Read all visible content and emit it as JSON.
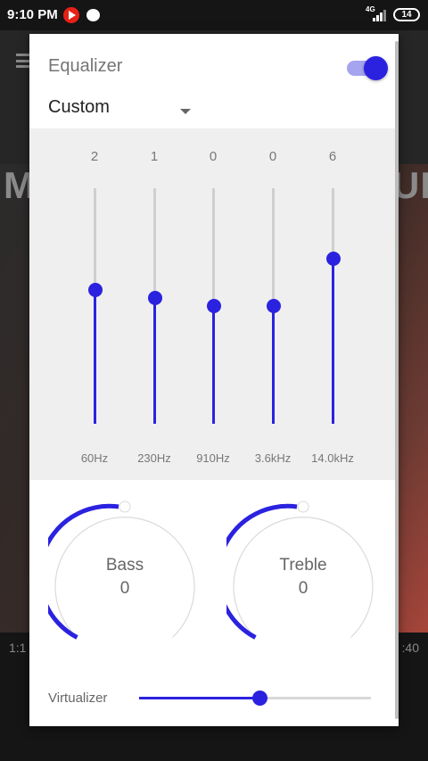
{
  "status_bar": {
    "time": "9:10 PM",
    "network": "4G",
    "battery": "14"
  },
  "background_player": {
    "elapsed": "1:1",
    "remaining": ":40",
    "title_fragment_left": "M",
    "title_fragment_right": "UE"
  },
  "dialog": {
    "title": "Equalizer",
    "enabled": true,
    "preset": "Custom",
    "bands": [
      {
        "freq": "60Hz",
        "value": "2",
        "level": 0.57
      },
      {
        "freq": "230Hz",
        "value": "1",
        "level": 0.535
      },
      {
        "freq": "910Hz",
        "value": "0",
        "level": 0.5
      },
      {
        "freq": "3.6kHz",
        "value": "0",
        "level": 0.5
      },
      {
        "freq": "14.0kHz",
        "value": "6",
        "level": 0.7
      }
    ],
    "knobs": [
      {
        "label": "Bass",
        "value": "0",
        "arc_color": "#2b22e0"
      },
      {
        "label": "Treble",
        "value": "0",
        "arc_color": "#2b22e0"
      }
    ],
    "virtualizer": {
      "label": "Virtualizer",
      "level": 0.52
    }
  },
  "colors": {
    "accent": "#2b22e0",
    "accent_light": "#a5a4ee",
    "panel": "#efefef"
  }
}
